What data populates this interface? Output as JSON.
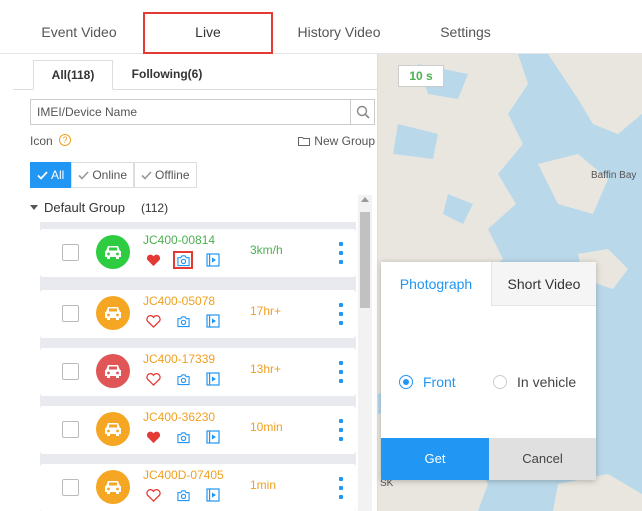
{
  "nav": {
    "tabs": [
      {
        "label": "Event Video"
      },
      {
        "label": "Live"
      },
      {
        "label": "History Video"
      },
      {
        "label": "Settings"
      }
    ]
  },
  "subtabs": {
    "all": "All(118)",
    "following": "Following(6)"
  },
  "search": {
    "placeholder": "IMEI/Device Name",
    "icon": "search-icon"
  },
  "icon_row": {
    "label": "Icon",
    "help_glyph": "?",
    "new_group": "New Group"
  },
  "filters": {
    "all": "All",
    "online": "Online",
    "offline": "Offline"
  },
  "group": {
    "name": "Default Group",
    "count": "(112)"
  },
  "devices": [
    {
      "name": "JC400-00814",
      "status": "3km/h",
      "name_color": "#4caf50",
      "status_color": "#4caf50",
      "avatar_color": "#2ecc40",
      "favorite": true
    },
    {
      "name": "JC400-05078",
      "status": "17hr+",
      "name_color": "#f0a020",
      "status_color": "#f0a020",
      "avatar_color": "#f5a623",
      "favorite": false
    },
    {
      "name": "JC400-17339",
      "status": "13hr+",
      "name_color": "#f0a020",
      "status_color": "#f0a020",
      "avatar_color": "#e05555",
      "favorite": false
    },
    {
      "name": "JC400-36230",
      "status": "10min",
      "name_color": "#f0a020",
      "status_color": "#f0a020",
      "avatar_color": "#f5a623",
      "favorite": true
    },
    {
      "name": "JC400D-07405",
      "status": "1min",
      "name_color": "#f0a020",
      "status_color": "#f0a020",
      "avatar_color": "#f5a623",
      "favorite": false
    }
  ],
  "map": {
    "timer": "10 s",
    "label_baffin": "Baffin Bay",
    "label_sk": "SK"
  },
  "popup": {
    "tab_photo": "Photograph",
    "tab_video": "Short Video",
    "option_front": "Front",
    "option_in_vehicle": "In vehicle",
    "get": "Get",
    "cancel": "Cancel"
  },
  "colors": {
    "accent": "#2196f3",
    "highlight": "#e53935"
  }
}
